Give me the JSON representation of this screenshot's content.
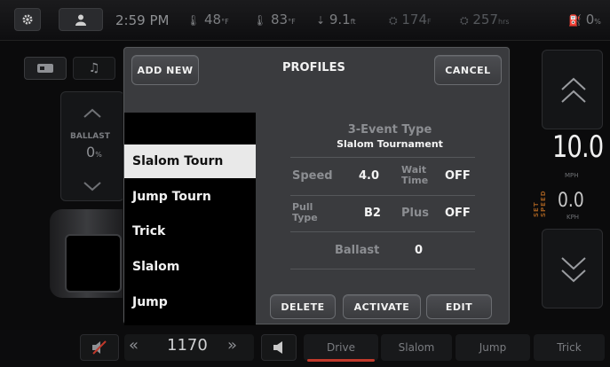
{
  "status": {
    "time": "2:59 PM",
    "stat1": "48",
    "stat1_unit": "°F",
    "stat2": "83",
    "stat2_unit": "°F",
    "stat3": "9.1",
    "stat3_unit": "ft",
    "stat4": "174",
    "stat4_unit": "F",
    "stat5": "257",
    "stat5_unit": "hrs",
    "fuel": "0",
    "fuel_unit": "%"
  },
  "left": {
    "ballast_label": "BALLAST",
    "ballast_value": "0",
    "ballast_unit": "%"
  },
  "right": {
    "set_speed_label": "SET SPEED",
    "mph_value": "10.0",
    "mph_unit": "MPH",
    "kph_value": "0.0",
    "kph_unit": "KPH"
  },
  "modal": {
    "title": "PROFILES",
    "add_new": "ADD NEW",
    "cancel": "CANCEL",
    "profiles": [
      "Slalom Tourn",
      "Jump Tourn",
      "Trick",
      "Slalom",
      "Jump"
    ],
    "selected_index": 0,
    "detail": {
      "event_type": "3-Event Type",
      "event_name": "Slalom Tournament",
      "speed_label": "Speed",
      "speed_value": "4.0",
      "wait_label_1": "Wait",
      "wait_label_2": "Time",
      "wait_value": "OFF",
      "pull_label_1": "Pull",
      "pull_label_2": "Type",
      "pull_value": "B2",
      "plus_label": "Plus",
      "plus_value": "OFF",
      "ballast_label": "Ballast",
      "ballast_value": "0"
    },
    "delete": "DELETE",
    "activate": "ACTIVATE",
    "edit": "EDIT"
  },
  "bottom": {
    "rpm": "1170",
    "tabs": [
      "Drive",
      "Slalom",
      "Jump",
      "Trick"
    ],
    "active_tab": "Drive"
  },
  "colors": {
    "accent_red": "#c0392b",
    "modal_bg": "#3a3b3e",
    "selected_row": "#e9e9e9"
  }
}
